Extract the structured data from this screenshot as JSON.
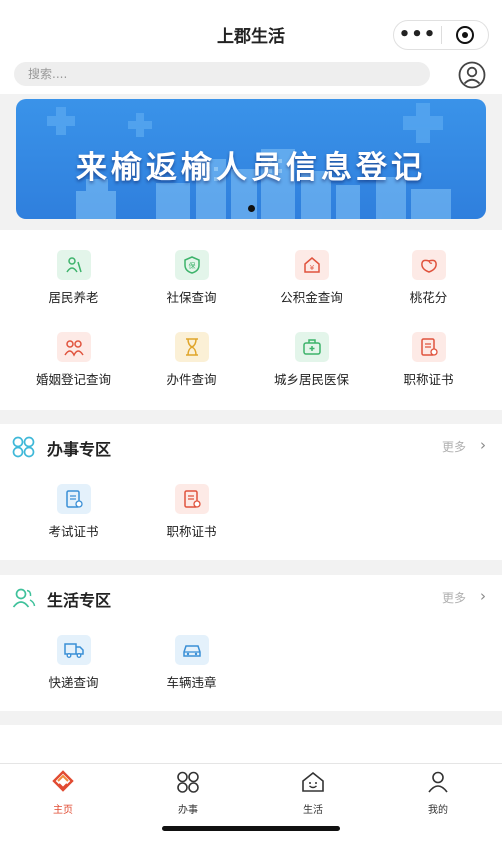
{
  "header": {
    "title": "上郡生活",
    "more_glyph": "•••"
  },
  "search": {
    "placeholder": "搜索...."
  },
  "banner": {
    "text": "来榆返榆人员信息登记"
  },
  "services": [
    {
      "label": "居民养老",
      "icon": "elderly-icon",
      "color": "#3db36b"
    },
    {
      "label": "社保查询",
      "icon": "social-security-icon",
      "color": "#3db36b"
    },
    {
      "label": "公积金查询",
      "icon": "housing-fund-icon",
      "color": "#e0533d"
    },
    {
      "label": "桃花分",
      "icon": "peach-icon",
      "color": "#e0533d"
    },
    {
      "label": "婚姻登记查询",
      "icon": "marriage-icon",
      "color": "#e0533d"
    },
    {
      "label": "办件查询",
      "icon": "hourglass-icon",
      "color": "#e0a52a"
    },
    {
      "label": "城乡居民医保",
      "icon": "medical-insurance-icon",
      "color": "#3db36b"
    },
    {
      "label": "职称证书",
      "icon": "certificate-icon",
      "color": "#e0533d"
    }
  ],
  "sections": [
    {
      "title": "办事专区",
      "more": "更多",
      "icon": "grid-icon",
      "items": [
        {
          "label": "考试证书",
          "icon": "exam-certificate-icon"
        },
        {
          "label": "职称证书",
          "icon": "title-certificate-icon"
        }
      ]
    },
    {
      "title": "生活专区",
      "more": "更多",
      "icon": "people-icon",
      "items": [
        {
          "label": "快递查询",
          "icon": "delivery-truck-icon"
        },
        {
          "label": "车辆违章",
          "icon": "car-icon"
        }
      ]
    }
  ],
  "tabs": [
    {
      "label": "主页",
      "icon": "home-logo-icon",
      "active": true
    },
    {
      "label": "办事",
      "icon": "grid-icon"
    },
    {
      "label": "生活",
      "icon": "life-house-icon"
    },
    {
      "label": "我的",
      "icon": "user-icon"
    }
  ],
  "colors": {
    "accent": "#e14b32",
    "banner_blue": "#3a93e9",
    "section_icon": "#3fb8d8"
  }
}
